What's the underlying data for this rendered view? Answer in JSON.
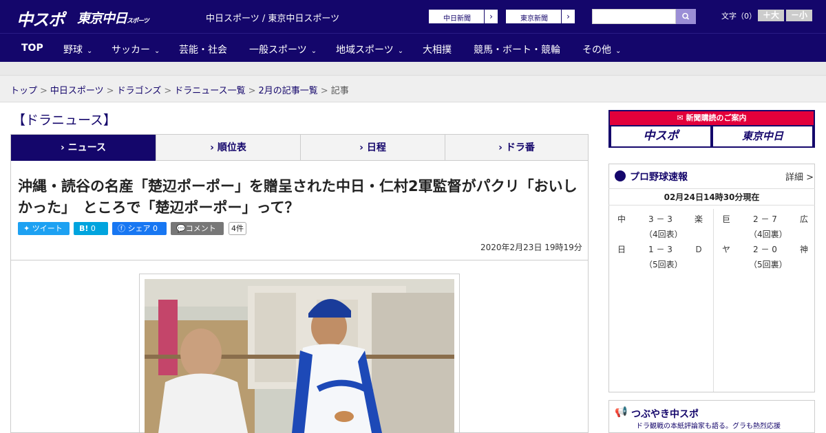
{
  "header": {
    "logo_chuspo": "中スポ",
    "logo_tokyo": "東京中日",
    "logo_tokyo_small": "スポーツ",
    "site_names": "中日スポーツ / 東京中日スポーツ",
    "chunichi_link": "中日新聞",
    "tokyo_link": "東京新聞",
    "font_size_label": "文字（0）",
    "font_larger": "＋大",
    "font_smaller": "－小"
  },
  "nav": {
    "top": "TOP",
    "baseball": "野球",
    "soccer": "サッカー",
    "entertainment": "芸能・社会",
    "sports": "一般スポーツ",
    "local": "地域スポーツ",
    "sumo": "大相撲",
    "racing": "競馬・ボート・競輪",
    "other": "その他"
  },
  "breadcrumb": {
    "top": "トップ",
    "chunichi_sports": "中日スポーツ",
    "dragons": "ドラゴンズ",
    "dragons_news": "ドラニュース一覧",
    "feb_articles": "2月の記事一覧",
    "current": "記事"
  },
  "section": {
    "title": "【ドラニュース】",
    "tabs": [
      "ニュース",
      "順位表",
      "日程",
      "ドラ番"
    ]
  },
  "article": {
    "headline": "沖縄・読谷の名産「楚辺ポーポー」を贈呈された中日・仁村2軍監督がパクリ「おいしかった」　ところで「楚辺ポーポー」って？",
    "tweet": "ツイート",
    "hatena": "0",
    "share": "シェア 0",
    "comment": "コメント",
    "comment_count": "4件",
    "date": "2020年2月23日 19時19分"
  },
  "sidebar": {
    "subscribe_title": "新聞購読のご案内",
    "subscribe_chuspo": "中スポ",
    "subscribe_tokyo": "東京中日",
    "score_title": "プロ野球速報",
    "score_detail": "詳細 >",
    "score_time": "02月24日14時30分現在",
    "games": [
      {
        "home": "中",
        "score": "3 － 3",
        "away": "楽",
        "inning": "（4回表）"
      },
      {
        "home": "巨",
        "score": "2 － 7",
        "away": "広",
        "inning": "（4回裏）"
      },
      {
        "home": "日",
        "score": "1 － 3",
        "away": "Ｄ",
        "inning": "（5回表）"
      },
      {
        "home": "ヤ",
        "score": "2 － 0",
        "away": "神",
        "inning": "（5回裏）"
      }
    ],
    "tweet_title": "つぶやき中スポ",
    "tweet_sub": "ドラ観戦の本紙評論家も語る。グラも熱烈応援"
  }
}
